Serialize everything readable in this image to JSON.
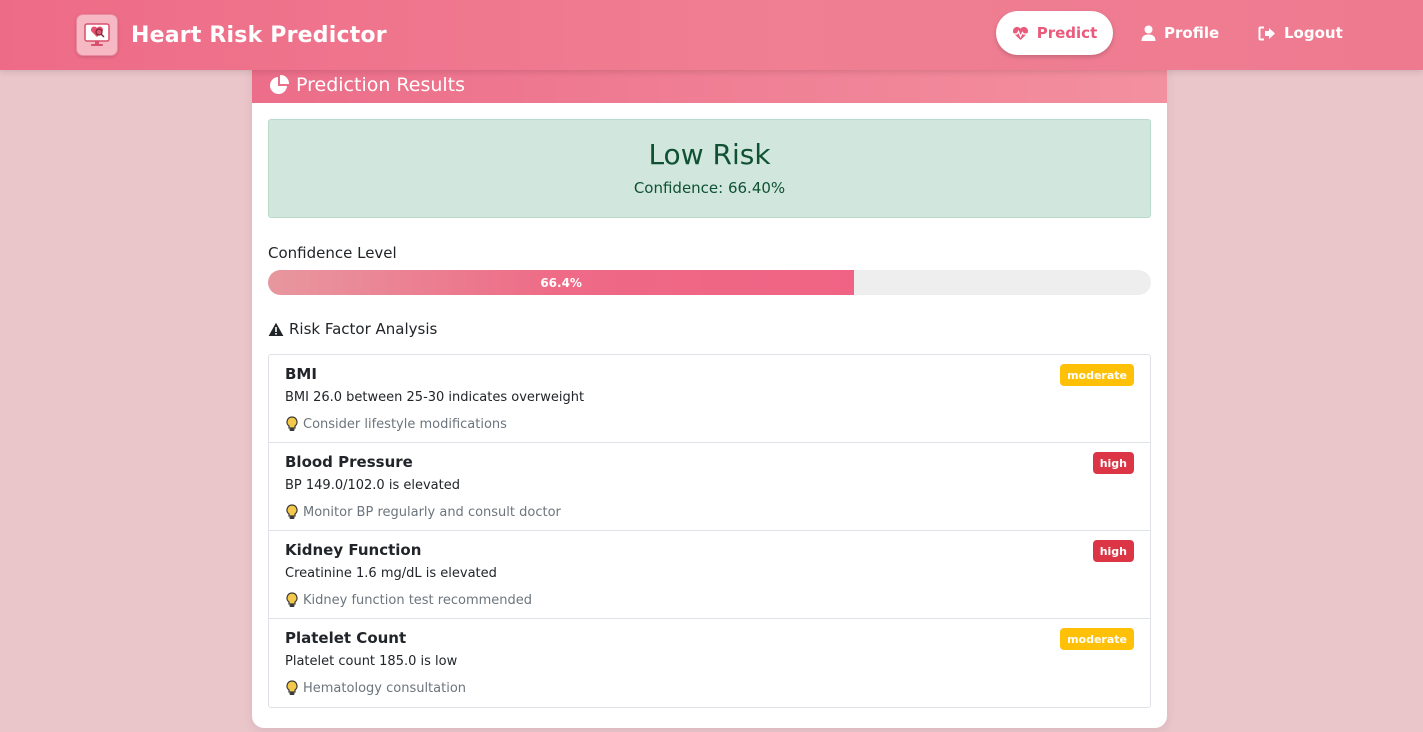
{
  "navbar": {
    "brand": "Heart Risk Predictor",
    "logo_icon": "heart-monitor-icon",
    "links": [
      {
        "label": "Predict",
        "icon": "heartbeat-icon",
        "active": true
      },
      {
        "label": "Profile",
        "icon": "user-icon"
      },
      {
        "label": "Logout",
        "icon": "sign-out-icon"
      }
    ]
  },
  "card": {
    "header": "Prediction Results",
    "header_icon": "pie-chart-icon"
  },
  "result": {
    "title": "Low Risk",
    "confidence_text": "Confidence: 66.40%"
  },
  "confidence": {
    "label": "Confidence Level",
    "value": 66.4,
    "bar_text": "66.4%"
  },
  "risk_analysis": {
    "heading": "Risk Factor Analysis",
    "heading_icon": "warning-icon",
    "factors": [
      {
        "name": "BMI",
        "severity": "moderate",
        "description": "BMI 26.0 between 25-30 indicates overweight",
        "tip": "Consider lifestyle modifications"
      },
      {
        "name": "Blood Pressure",
        "severity": "high",
        "description": "BP 149.0/102.0 is elevated",
        "tip": "Monitor BP regularly and consult doctor"
      },
      {
        "name": "Kidney Function",
        "severity": "high",
        "description": "Creatinine 1.6 mg/dL is elevated",
        "tip": "Kidney function test recommended"
      },
      {
        "name": "Platelet Count",
        "severity": "moderate",
        "description": "Platelet count 185.0 is low",
        "tip": "Hematology consultation"
      }
    ]
  },
  "colors": {
    "brand_pink": "#ee6b87",
    "success_bg": "#d1e7de",
    "moderate": "#ffc107",
    "high": "#dc3545"
  }
}
